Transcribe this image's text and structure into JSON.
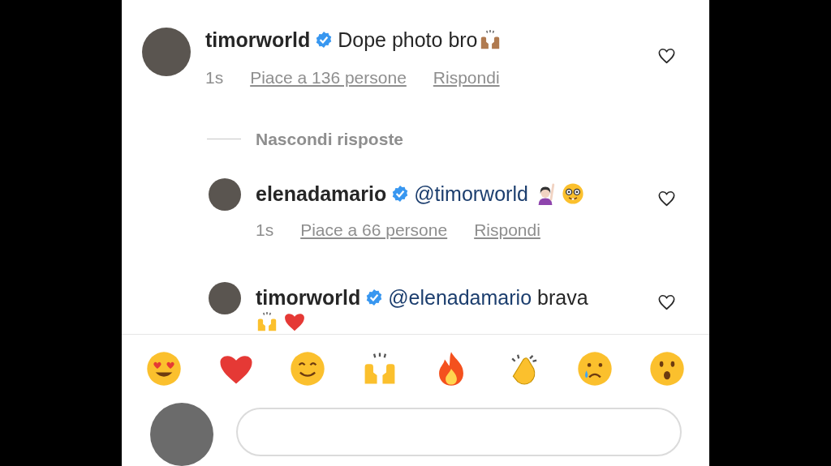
{
  "comment": {
    "username": "timorworld",
    "verified": true,
    "text": "Dope photo bro",
    "emojis": [
      {
        "kind": "raising-hands-tan"
      }
    ],
    "time": "1s",
    "likes": "Piace a 136 persone",
    "reply": "Rispondi"
  },
  "toggle": "Nascondi risposte",
  "replies": [
    {
      "username": "elenadamario",
      "verified": true,
      "mention": "@timorworld",
      "emojis": [
        {
          "kind": "person-raising-hand"
        },
        {
          "kind": "nerd"
        }
      ],
      "time": "1s",
      "likes": "Piace a 66 persone",
      "reply": "Rispondi"
    },
    {
      "username": "timorworld",
      "verified": true,
      "mention": "@elenadamario",
      "text": "brava",
      "emojis": [
        {
          "kind": "raising-hands"
        },
        {
          "kind": "heart"
        }
      ]
    }
  ],
  "reactions": [
    {
      "kind": "heart-eyes"
    },
    {
      "kind": "heart"
    },
    {
      "kind": "smile"
    },
    {
      "kind": "raising-hands"
    },
    {
      "kind": "fire"
    },
    {
      "kind": "clap"
    },
    {
      "kind": "sad-tear"
    },
    {
      "kind": "surprised"
    }
  ]
}
